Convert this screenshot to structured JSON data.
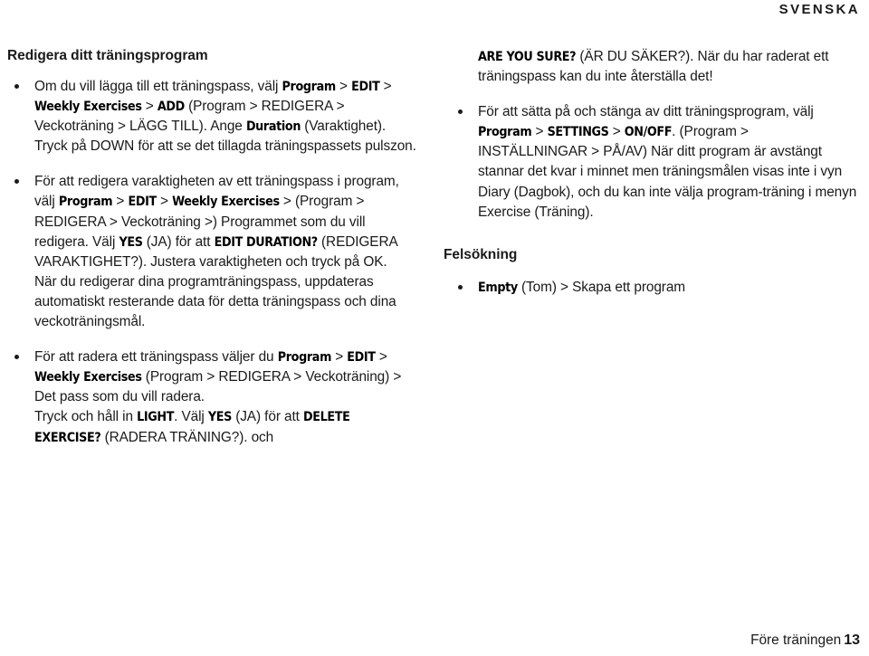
{
  "header": {
    "language": "SVENSKA"
  },
  "footer": {
    "chapter": "Före träningen",
    "page_number": "13"
  },
  "left_column": {
    "title": "Redigera ditt träningsprogram",
    "bullets": [
      {
        "id": "add-exercise",
        "parts": [
          {
            "type": "plain",
            "text": "Om du vill lägga till ett träningspass, välj "
          },
          {
            "type": "device",
            "text": "Program"
          },
          {
            "type": "sep",
            "text": " > "
          },
          {
            "type": "device",
            "text": "EDIT"
          },
          {
            "type": "sep",
            "text": " > "
          },
          {
            "type": "device",
            "text": "Weekly Exercises"
          },
          {
            "type": "sep",
            "text": " > "
          },
          {
            "type": "device",
            "text": "ADD"
          },
          {
            "type": "plain",
            "text": " (Program > REDIGERA > Veckoträning > LÄGG TILL). Ange "
          },
          {
            "type": "device",
            "text": "Duration"
          },
          {
            "type": "plain",
            "text": " (Varaktighet). Tryck på DOWN för att se det tillagda träningspassets pulszon."
          }
        ]
      },
      {
        "id": "edit-duration",
        "parts": [
          {
            "type": "plain",
            "text": "För att redigera varaktigheten av ett träningspass i program, välj "
          },
          {
            "type": "device",
            "text": "Program"
          },
          {
            "type": "sep",
            "text": " > "
          },
          {
            "type": "device",
            "text": "EDIT"
          },
          {
            "type": "sep",
            "text": " > "
          },
          {
            "type": "device",
            "text": "Weekly Exercises"
          },
          {
            "type": "plain",
            "text": " > (Program > REDIGERA > Veckoträning >) Programmet som du vill redigera. Välj "
          },
          {
            "type": "device",
            "text": "YES"
          },
          {
            "type": "plain",
            "text": " (JA) för att "
          },
          {
            "type": "device",
            "text": "EDIT DURATION?"
          },
          {
            "type": "plain",
            "text": " (REDIGERA VARAKTIGHET?). Justera varaktigheten och tryck på OK."
          },
          {
            "type": "break",
            "text": ""
          },
          {
            "type": "plain",
            "text": "När du redigerar dina programträningspass, uppdateras automatiskt resterande data för detta träningspass och dina veckoträningsmål."
          }
        ]
      },
      {
        "id": "delete-exercise",
        "parts": [
          {
            "type": "plain",
            "text": "För att radera ett träningspass väljer du "
          },
          {
            "type": "device",
            "text": "Program"
          },
          {
            "type": "sep",
            "text": " > "
          },
          {
            "type": "device",
            "text": "EDIT"
          },
          {
            "type": "sep",
            "text": " > "
          },
          {
            "type": "device",
            "text": "Weekly Exercises"
          },
          {
            "type": "plain",
            "text": " (Program > REDIGERA > Veckoträning) > Det pass som du vill radera."
          },
          {
            "type": "break",
            "text": ""
          },
          {
            "type": "plain",
            "text": "Tryck och håll in "
          },
          {
            "type": "device",
            "text": "LIGHT"
          },
          {
            "type": "plain",
            "text": ". Välj "
          },
          {
            "type": "device",
            "text": "YES"
          },
          {
            "type": "plain",
            "text": " (JA) för att "
          },
          {
            "type": "device",
            "text": "DELETE EXERCISE?"
          },
          {
            "type": "plain",
            "text": " (RADERA TRÄNING?). och"
          }
        ]
      }
    ]
  },
  "right_column": {
    "continuation": {
      "parts": [
        {
          "type": "device",
          "text": "ARE YOU SURE?"
        },
        {
          "type": "plain",
          "text": " (ÄR DU SÄKER?). När du har raderat ett träningspass kan du inte återställa det!"
        }
      ]
    },
    "bullets": [
      {
        "id": "program-on-off",
        "parts": [
          {
            "type": "plain",
            "text": "För att sätta på och stänga av ditt träningsprogram, välj "
          },
          {
            "type": "device",
            "text": "Program"
          },
          {
            "type": "sep",
            "text": " > "
          },
          {
            "type": "device",
            "text": "SETTINGS"
          },
          {
            "type": "sep",
            "text": " > "
          },
          {
            "type": "device",
            "text": "ON/OFF"
          },
          {
            "type": "plain",
            "text": ". (Program > INSTÄLLNINGAR > PÅ/AV) När ditt program är avstängt stannar det kvar i minnet men träningsmålen visas inte i vyn Diary (Dagbok), och du kan inte välja program-träning i menyn Exercise (Träning)."
          }
        ]
      }
    ],
    "troubleshooting": {
      "title": "Felsökning",
      "bullets": [
        {
          "id": "empty-program",
          "parts": [
            {
              "type": "device",
              "text": "Empty"
            },
            {
              "type": "plain",
              "text": " (Tom) > Skapa ett program"
            }
          ]
        }
      ]
    }
  },
  "colors": {
    "text": "#1a1a1a",
    "background": "#ffffff"
  }
}
